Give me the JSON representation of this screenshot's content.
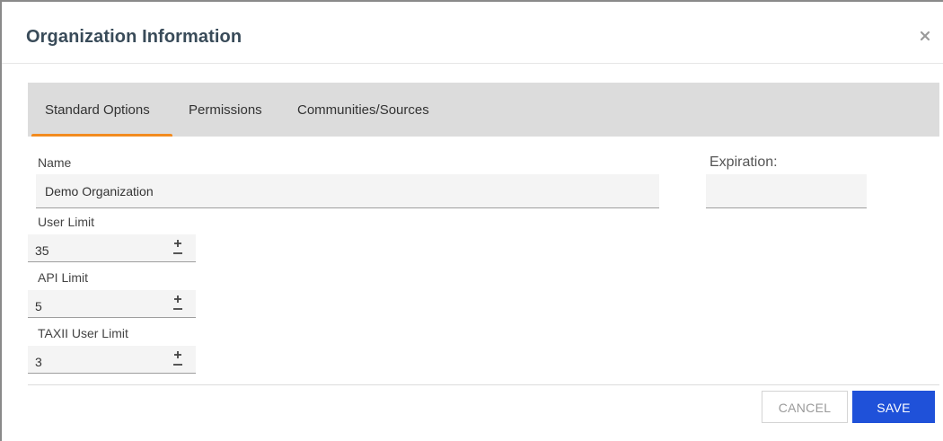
{
  "dialog": {
    "title": "Organization Information"
  },
  "tabs": [
    {
      "label": "Standard Options",
      "active": true
    },
    {
      "label": "Permissions",
      "active": false
    },
    {
      "label": "Communities/Sources",
      "active": false
    }
  ],
  "form": {
    "name": {
      "label": "Name",
      "value": "Demo Organization"
    },
    "expiration": {
      "label": "Expiration:",
      "value": ""
    },
    "user_limit": {
      "label": "User Limit",
      "value": "35"
    },
    "api_limit": {
      "label": "API Limit",
      "value": "5"
    },
    "taxii_user_limit": {
      "label": "TAXII User Limit",
      "value": "3"
    }
  },
  "footer": {
    "cancel_label": "CANCEL",
    "save_label": "SAVE"
  },
  "colors": {
    "accent_tab_underline": "#f28b1f",
    "primary_button": "#1f51d9",
    "title": "#394b59"
  },
  "icons": {
    "close": "close-icon",
    "stepper": "plus-minus-icon"
  }
}
